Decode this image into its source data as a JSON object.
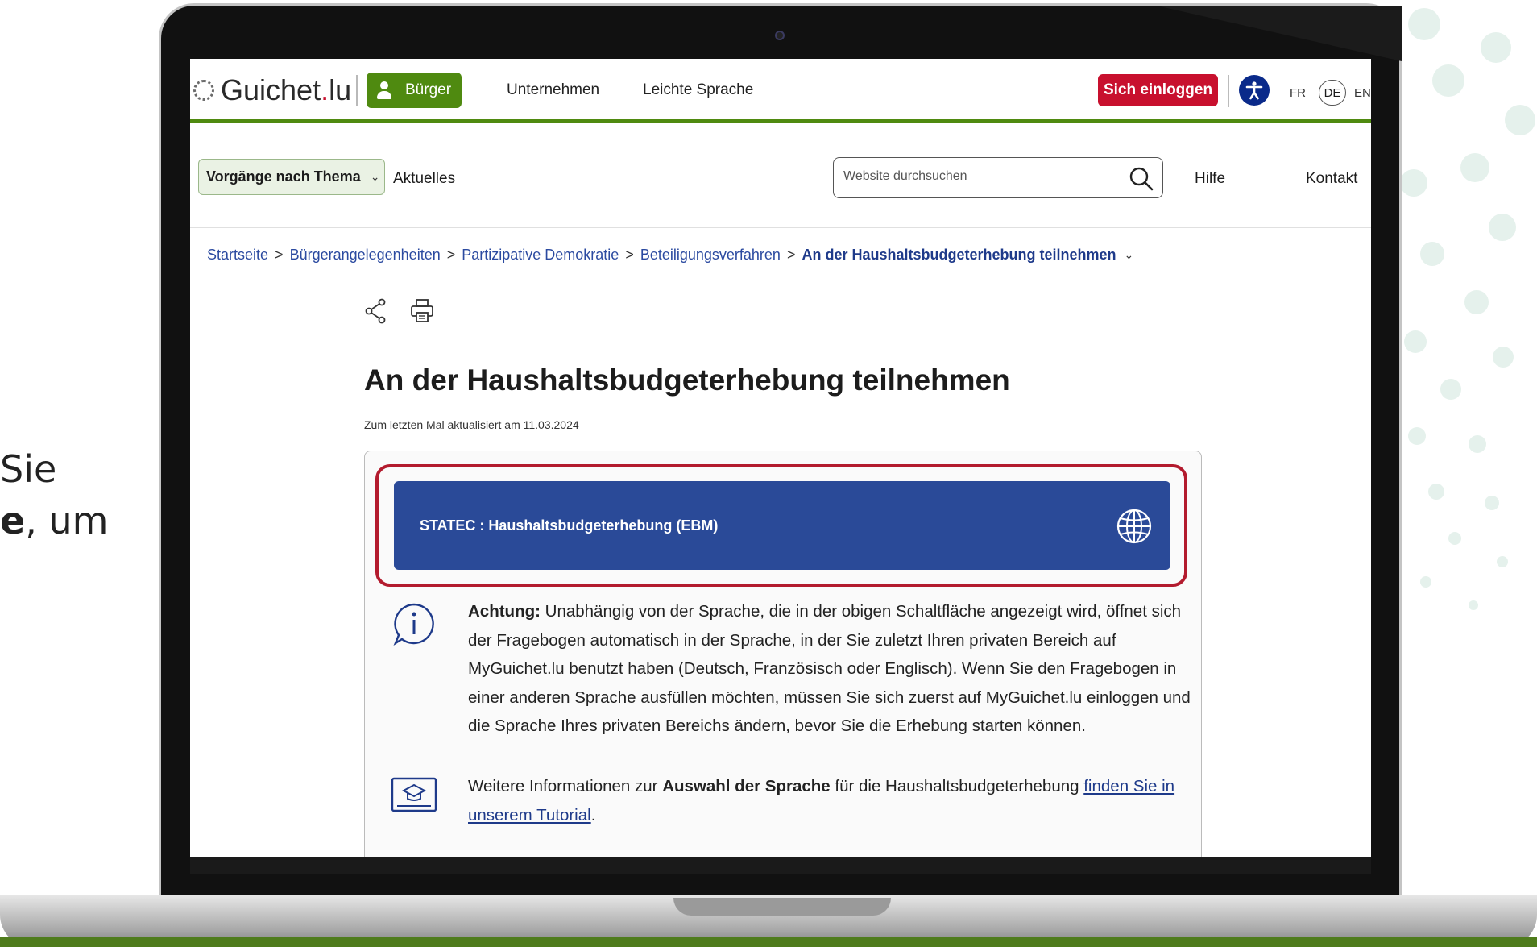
{
  "side_text": {
    "line1": "Sie",
    "line2_bold": "e",
    "line2_rest": ", um"
  },
  "header": {
    "logo_text_main": "Guichet",
    "logo_text_dot": ".",
    "logo_text_tld": "lu",
    "audience_active": "Bürger",
    "nav": [
      "Unternehmen",
      "Leichte Sprache"
    ],
    "login_label": "Sich einloggen",
    "languages": [
      "FR",
      "DE",
      "EN"
    ],
    "active_language": "DE"
  },
  "subnav": {
    "topics_label": "Vorgänge nach Thema",
    "news_label": "Aktuelles",
    "search_placeholder": "Website durchsuchen",
    "help_label": "Hilfe",
    "contact_label": "Kontakt"
  },
  "breadcrumb": [
    "Startseite",
    "Bürgerangelegenheiten",
    "Partizipative Demokratie",
    "Beteiligungsverfahren",
    "An der Haushaltsbudgeterhebung teilnehmen"
  ],
  "page": {
    "title": "An der Haushaltsbudgeterhebung teilnehmen",
    "updated": "Zum letzten Mal aktualisiert am 11.03.2024",
    "action_button": "STATEC : Haushaltsbudgeterhebung (EBM)",
    "notice_bold": "Achtung:",
    "notice_text": " Unabhängig von der Sprache, die in der obigen Schaltfläche angezeigt wird, öffnet sich der Fragebogen automatisch in der Sprache, in der Sie zuletzt Ihren privaten Bereich auf MyGuichet.lu benutzt haben (Deutsch, Französisch oder Englisch). Wenn Sie den Fragebogen in einer anderen Sprache ausfüllen möchten, müssen Sie sich zuerst auf MyGuichet.lu einloggen und die Sprache Ihres privaten Bereichs ändern, bevor Sie die Erhebung starten können.",
    "info_pre": "Weitere Informationen zur ",
    "info_bold": "Auswahl der Sprache",
    "info_mid": " für die Haushaltsbudgeterhebung ",
    "info_link": "finden Sie in unserem Tutorial",
    "info_end": "."
  },
  "colors": {
    "green": "#4f8a10",
    "red": "#c8102e",
    "blue": "#2a4a98",
    "highlight": "#b31b2e"
  }
}
